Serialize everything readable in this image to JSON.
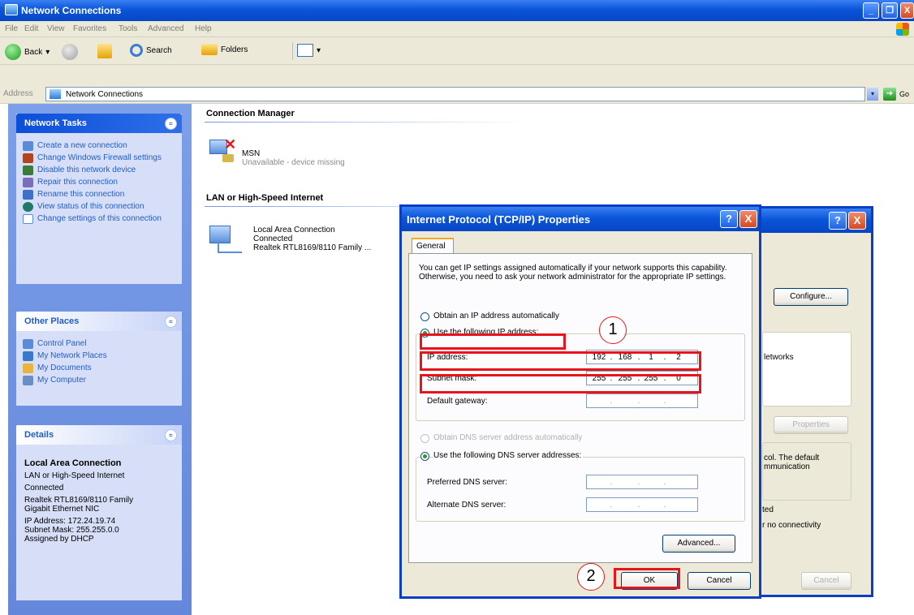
{
  "window": {
    "title": "Network Connections",
    "controls": {
      "minimize": "_",
      "maximize": "❐",
      "close": "X"
    }
  },
  "menu": [
    "File",
    "Edit",
    "View",
    "Favorites",
    "Tools",
    "Advanced",
    "Help"
  ],
  "toolbar": {
    "back": "Back",
    "back_arrow": "▾",
    "search": "Search",
    "folders": "Folders",
    "views_arrow": "▾"
  },
  "address": {
    "label": "Address",
    "value": "Network Connections",
    "dropdown": "▾",
    "go_arrow": "➔",
    "go": "Go"
  },
  "tasks": {
    "network_tasks": {
      "title": "Network Tasks",
      "items": [
        "Create a new connection",
        "Change Windows Firewall settings",
        "Disable this network device",
        "Repair this connection",
        "Rename this connection",
        "View status of this connection",
        "Change settings of this connection"
      ]
    },
    "other_places": {
      "title": "Other Places",
      "items": [
        "Control Panel",
        "My Network Places",
        "My Documents",
        "My Computer"
      ]
    },
    "details": {
      "title": "Details",
      "name": "Local Area Connection",
      "lines": [
        "LAN or High-Speed Internet",
        "Connected",
        "Realtek RTL8169/8110 Family Gigabit Ethernet NIC",
        "IP Address: 172.24.19.74",
        "Subnet Mask: 255.255.0.0",
        "Assigned by DHCP"
      ]
    },
    "collapse_glyph": "≈"
  },
  "content": {
    "connection_manager": {
      "heading": "Connection Manager",
      "name": "MSN",
      "status": "Unavailable - device missing"
    },
    "lan": {
      "heading": "LAN or High-Speed Internet",
      "name": "Local Area Connection",
      "status": "Connected",
      "device": "Realtek RTL8169/8110 Family ..."
    }
  },
  "bg_dialog": {
    "help": "?",
    "close": "X",
    "configure": "Configure...",
    "fragment_networks": "letworks",
    "properties": "Properties",
    "fragment_protocol_1": "col. The default",
    "fragment_protocol_2": "mmunication",
    "fragment_notify_1": "ted",
    "fragment_notify_2": "r no connectivity",
    "cancel": "Cancel"
  },
  "dialog": {
    "title": "Internet Protocol (TCP/IP) Properties",
    "help": "?",
    "close": "X",
    "tab": "General",
    "intro": "You can get IP settings assigned automatically if your network supports this capability. Otherwise, you need to ask your network administrator for the appropriate IP settings.",
    "obtain_auto": "Obtain an IP address automatically",
    "use_following": "Use the following IP address:",
    "ip_label": "IP address:",
    "ip_octets": [
      "192",
      "168",
      "1",
      "2"
    ],
    "subnet_label": "Subnet mask:",
    "subnet_octets": [
      "255",
      "255",
      "255",
      "0"
    ],
    "gateway_label": "Default gateway:",
    "dns_auto": "Obtain DNS server address automatically",
    "dns_following": "Use the following DNS server addresses:",
    "preferred_dns": "Preferred DNS server:",
    "alternate_dns": "Alternate DNS server:",
    "ip_dot": ".",
    "advanced": "Advanced...",
    "ok": "OK",
    "cancel": "Cancel"
  },
  "annotations": {
    "step1": "1",
    "step2": "2",
    "color": "#e8141c"
  }
}
